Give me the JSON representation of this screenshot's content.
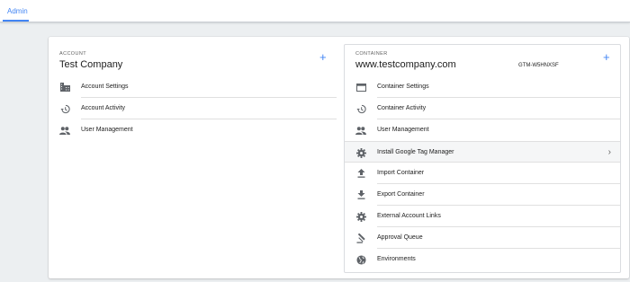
{
  "nav": {
    "tab_label": "Admin"
  },
  "colors": {
    "accent": "#4285f4",
    "icon": "#5f6368"
  },
  "account": {
    "section_label": "ACCOUNT",
    "name": "Test Company",
    "add_icon": "plus-icon",
    "items": [
      {
        "label": "Account Settings",
        "icon": "building-icon"
      },
      {
        "label": "Account Activity",
        "icon": "history-icon"
      },
      {
        "label": "User Management",
        "icon": "people-icon"
      }
    ]
  },
  "container": {
    "section_label": "CONTAINER",
    "name": "www.testcompany.com",
    "id": "GTM-W5HNXSF",
    "add_icon": "plus-icon",
    "items": [
      {
        "label": "Container Settings",
        "icon": "container-icon"
      },
      {
        "label": "Container Activity",
        "icon": "history-icon"
      },
      {
        "label": "User Management",
        "icon": "people-icon"
      },
      {
        "label": "Install Google Tag Manager",
        "icon": "gear-icon",
        "chevron": "chevron-right-icon"
      },
      {
        "label": "Import Container",
        "icon": "upload-icon"
      },
      {
        "label": "Export Container",
        "icon": "download-icon"
      },
      {
        "label": "External Account Links",
        "icon": "gear-icon"
      },
      {
        "label": "Approval Queue",
        "icon": "gavel-icon"
      },
      {
        "label": "Environments",
        "icon": "globe-icon"
      }
    ]
  }
}
